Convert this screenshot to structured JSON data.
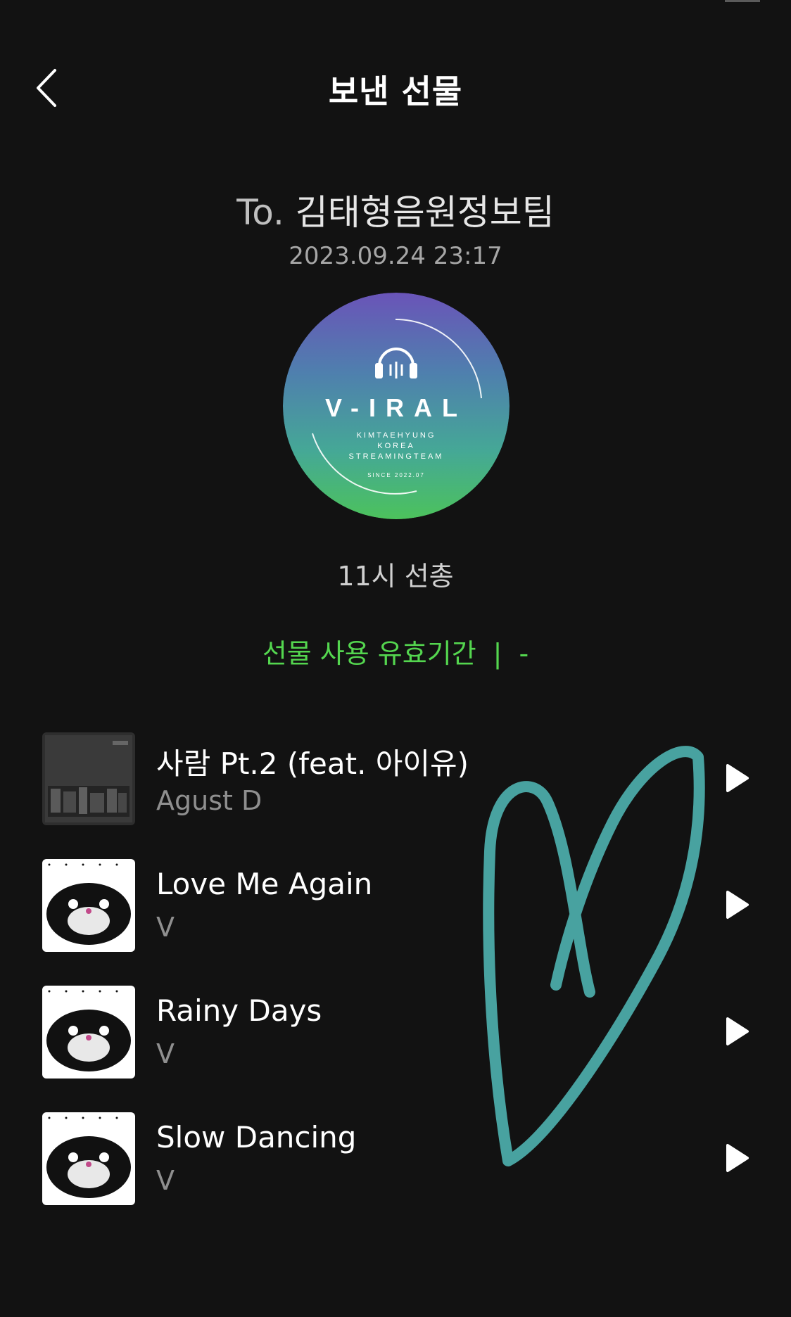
{
  "header": {
    "title": "보낸 선물",
    "back_icon": "chevron-left-icon"
  },
  "gift": {
    "to_prefix": "To.",
    "recipient": "김태형음원정보팀",
    "datetime": "2023.09.24 23:17",
    "cover_text": {
      "brand": "V-IRAL",
      "line1": "KIMTAEHYUNG",
      "line2": "KOREA",
      "line3": "STREAMINGTEAM",
      "since": "SINCE 2022.07"
    },
    "message": "11시 선총",
    "validity_label": "선물 사용 유효기간",
    "validity_sep": "|",
    "validity_value": "-"
  },
  "tracks": [
    {
      "title": "사람 Pt.2 (feat. 아이유)",
      "artist": "Agust D",
      "art": "agust-d-album-art"
    },
    {
      "title": "Love Me Again",
      "artist": "V",
      "art": "v-layover-album-art"
    },
    {
      "title": "Rainy Days",
      "artist": "V",
      "art": "v-layover-album-art"
    },
    {
      "title": "Slow Dancing",
      "artist": "V",
      "art": "v-layover-album-art"
    }
  ],
  "colors": {
    "background": "#121212",
    "accent_green": "#54d64f",
    "heart_stroke": "#4fb3b0"
  }
}
